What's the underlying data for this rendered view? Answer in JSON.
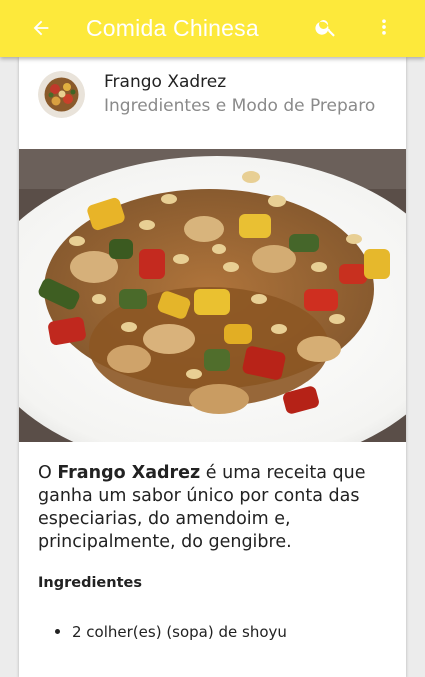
{
  "appbar": {
    "title": "Comida Chinesa",
    "icons": [
      "back-arrow-icon",
      "search-icon",
      "more-vert-icon"
    ],
    "color": "#fde93b"
  },
  "recipe": {
    "name": "Frango Xadrez",
    "subtitle": "Ingredientes e Modo de Preparo",
    "description": {
      "prefix": "O ",
      "bold": "Frango Xadrez",
      "suffix": " é uma receita que ganha um sabor único por conta das especiarias, do amendoim e, principalmente, do gengibre."
    },
    "ingredients_heading": "Ingredientes",
    "ingredients": [
      "2 colher(es) (sopa) de shoyu"
    ]
  }
}
